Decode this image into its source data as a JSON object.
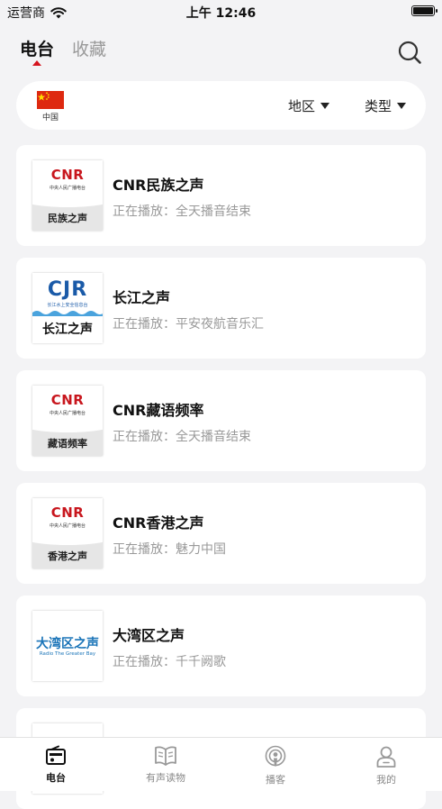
{
  "status": {
    "carrier": "运营商",
    "time": "上午 12:46"
  },
  "top_tabs": [
    {
      "label": "电台",
      "active": true
    },
    {
      "label": "收藏",
      "active": false
    }
  ],
  "filter": {
    "country": "中国",
    "region_label": "地区",
    "type_label": "类型"
  },
  "stations": [
    {
      "title": "CNR民族之声",
      "status": "正在播放：全天播音结束",
      "logo": {
        "brand": "CNR",
        "sub": "中央人民广播电台",
        "name": "民族之声"
      }
    },
    {
      "title": "长江之声",
      "status": "正在播放：平安夜航音乐汇",
      "logo": {
        "brand": "CJR",
        "sub": "长江水上安全信息台",
        "name": "长江之声"
      }
    },
    {
      "title": "CNR藏语频率",
      "status": "正在播放：全天播音结束",
      "logo": {
        "brand": "CNR",
        "sub": "中央人民广播电台",
        "name": "藏语频率"
      }
    },
    {
      "title": "CNR香港之声",
      "status": "正在播放：魅力中国",
      "logo": {
        "brand": "CNR",
        "sub": "中央人民广播电台",
        "name": "香港之声"
      }
    },
    {
      "title": "大湾区之声",
      "status": "正在播放：千千阙歌",
      "logo": {
        "brand": "大湾区之声",
        "sub": "Radio The Greater Bay"
      }
    }
  ],
  "tabbar": [
    {
      "label": "电台",
      "icon": "radio-icon",
      "active": true
    },
    {
      "label": "有声读物",
      "icon": "book-icon",
      "active": false
    },
    {
      "label": "播客",
      "icon": "podcast-icon",
      "active": false
    },
    {
      "label": "我的",
      "icon": "user-icon",
      "active": false
    }
  ],
  "colors": {
    "accent": "#d5141e",
    "background": "#f3f3f5",
    "card": "#ffffff",
    "muted": "#999999"
  }
}
